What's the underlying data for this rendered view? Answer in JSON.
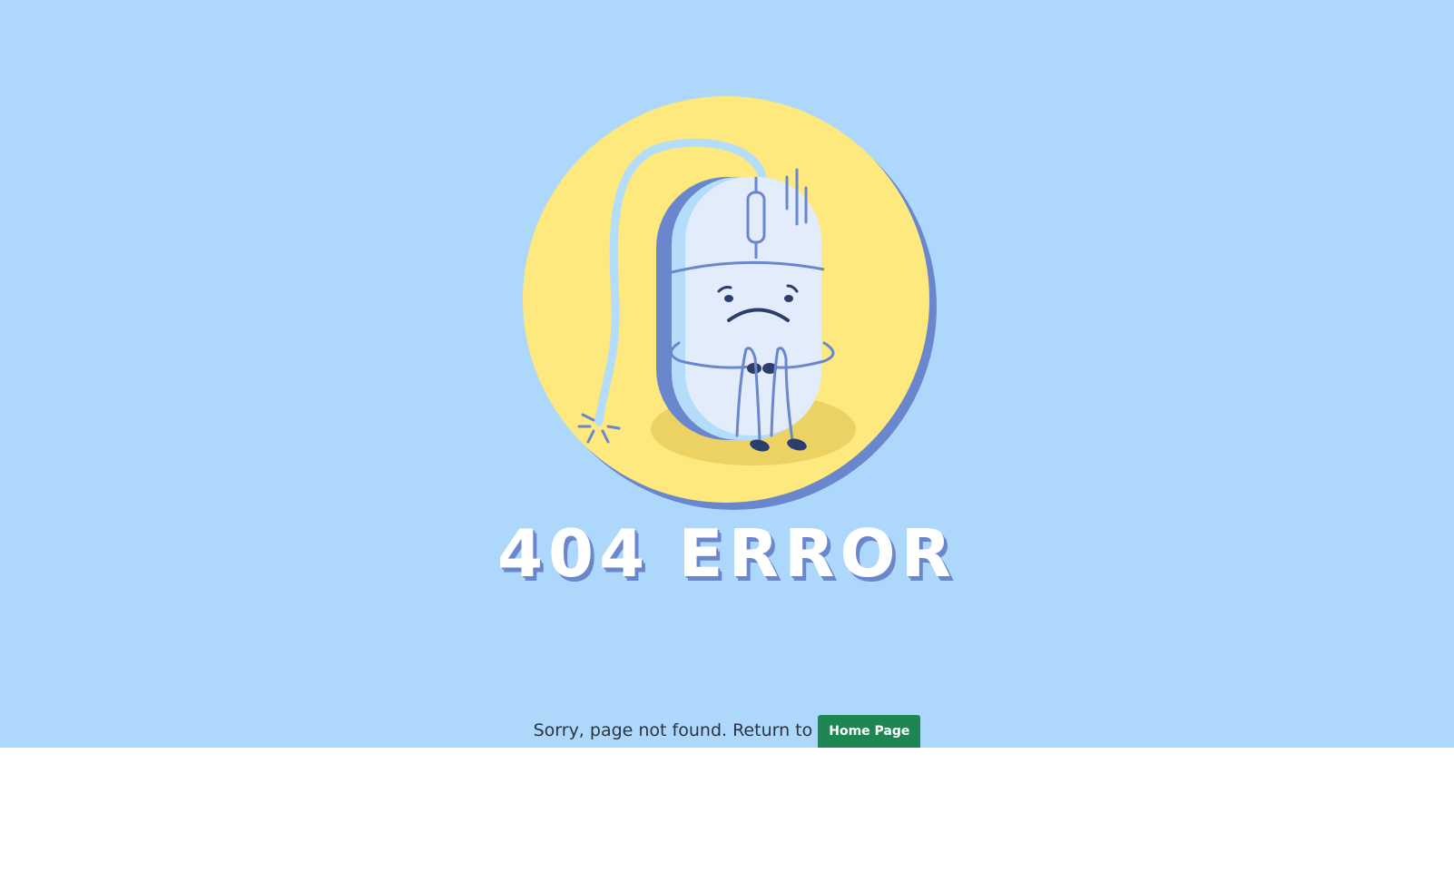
{
  "error": {
    "title": "404 ERROR",
    "message": "Sorry, page not found. Return to",
    "home_button_label": "Home Page"
  },
  "illustration": {
    "subject": "sad-computer-mouse-icon",
    "colors": {
      "background": "#add8fb",
      "circle": "#fde97d",
      "shadow": "#6a87ce",
      "mouse_body": "#e2ecfb",
      "floor_shadow": "#ecd262"
    }
  },
  "colors": {
    "button": "#1e8653",
    "text": "#2b3440",
    "title_shadow": "#6a87ce"
  }
}
